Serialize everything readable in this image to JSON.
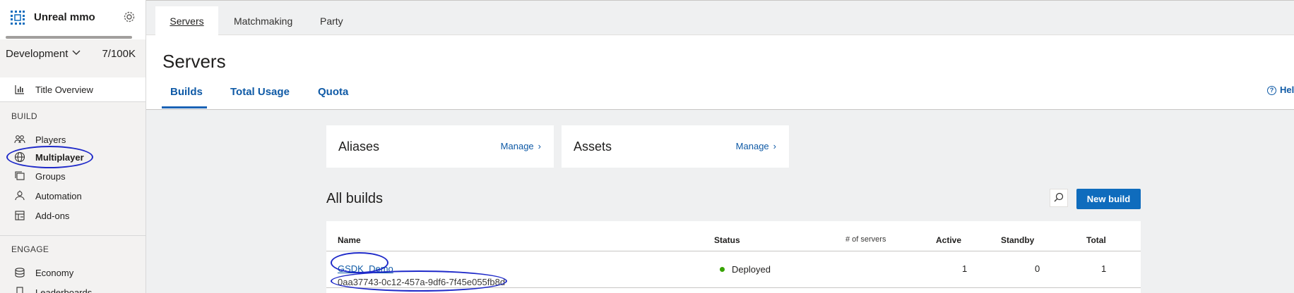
{
  "sidebar": {
    "app_name": "Unreal mmo",
    "environment": "Development",
    "count": "7/100K",
    "title_overview": "Title Overview",
    "build_section": "BUILD",
    "build_items": [
      "Players",
      "Multiplayer",
      "Groups",
      "Automation",
      "Add-ons"
    ],
    "engage_section": "ENGAGE",
    "engage_items": [
      "Economy",
      "Leaderboards"
    ]
  },
  "top_tabs": [
    "Servers",
    "Matchmaking",
    "Party"
  ],
  "page": {
    "title": "Servers",
    "subtabs": [
      "Builds",
      "Total Usage",
      "Quota"
    ],
    "help": "Help"
  },
  "cards": [
    {
      "title": "Aliases",
      "link": "Manage"
    },
    {
      "title": "Assets",
      "link": "Manage"
    }
  ],
  "builds": {
    "heading": "All builds",
    "new_build_label": "New build",
    "columns": [
      "Name",
      "Status",
      "# of servers",
      "Active",
      "Standby",
      "Total"
    ],
    "rows": [
      {
        "name": "GSDK_Demo",
        "id": "0aa37743-0c12-457a-9df6-7f45e055fb8d",
        "status": "Deployed",
        "active": "1",
        "standby": "0",
        "total": "1"
      }
    ]
  },
  "colors": {
    "accent": "#0f6cbd",
    "link": "#0f5aa6",
    "status_ok": "#37a300",
    "annotation": "#1f2ac9"
  }
}
